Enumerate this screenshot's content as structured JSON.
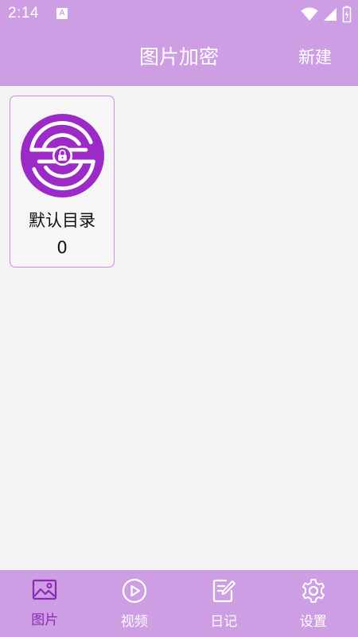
{
  "status_bar": {
    "time": "2:14",
    "notification_icon": "a-icon",
    "notification_letter": "A",
    "icons": [
      "wifi-icon",
      "signal-icon",
      "battery-icon"
    ]
  },
  "app_bar": {
    "title": "图片加密",
    "new_label": "新建"
  },
  "folders": [
    {
      "name": "默认目录",
      "count": "0",
      "icon": "lock-logo-icon"
    }
  ],
  "bottom_nav": {
    "items": [
      {
        "label": "图片",
        "icon": "image-icon",
        "active": true
      },
      {
        "label": "视频",
        "icon": "play-icon",
        "active": false
      },
      {
        "label": "日记",
        "icon": "note-edit-icon",
        "active": false
      },
      {
        "label": "设置",
        "icon": "gear-icon",
        "active": false
      }
    ]
  },
  "colors": {
    "bar_background": "#cd9ee3",
    "accent": "#9b2fc5",
    "logo_fill": "#9b2ac6",
    "content_background": "#f4f4f4",
    "card_border": "#c98fe0",
    "active_nav": "#8e29b5",
    "inactive_nav": "#ffffff"
  }
}
